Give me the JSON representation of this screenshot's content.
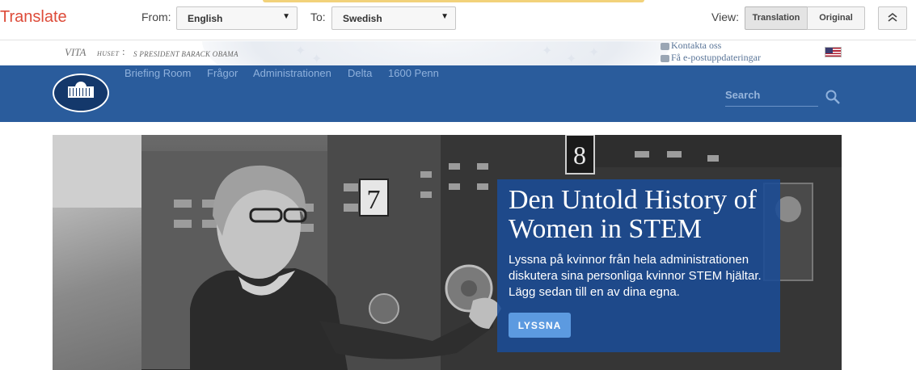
{
  "translate_bar": {
    "brand": "Translate",
    "from_label": "From:",
    "from_value": "English",
    "to_label": "To:",
    "to_value": "Swedish",
    "view_label": "View:",
    "view_translation": "Translation",
    "view_original": "Original",
    "dropdown_arrow": "▼"
  },
  "site_header": {
    "logo_text_1": "VITA",
    "logo_text_2": "HUSET",
    "colon": ":",
    "logo_text_3": "S PRESIDENT BARACK OBAMA",
    "contact": "Kontakta oss",
    "email_updates": "Få e-postuppdateringar"
  },
  "nav": {
    "items": [
      "Briefing Room",
      "Frågor",
      "Administrationen",
      "Delta",
      "1600 Penn"
    ],
    "search_placeholder": "Search"
  },
  "hero": {
    "title": "Den Untold History of Women in STEM",
    "description": "Lyssna på kvinnor från hela administrationen diskutera sina personliga kvinnor STEM hjältar. Lägg sedan till en av dina egna.",
    "button": "LYSSNA",
    "panel_number_1": "8",
    "panel_number_2": "7"
  },
  "colors": {
    "brand_red": "#dd4b39",
    "nav_blue": "#2a5c9c",
    "panel_blue": "#1b4c96",
    "button_blue": "#5c9ae0"
  },
  "icons": [
    "search-icon",
    "chevron-up-icon",
    "white-house-logo",
    "us-flag-icon",
    "mail-icon",
    "speech-bubble-icon"
  ]
}
